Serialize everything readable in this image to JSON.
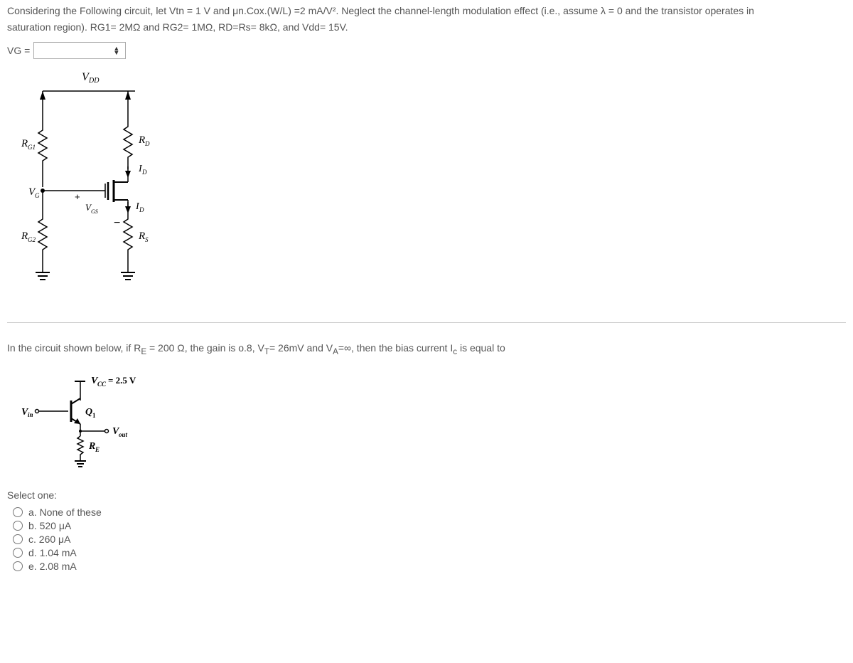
{
  "question1": {
    "line1": "Considering the Following circuit,  let Vtn = 1 V and  μn.Cox.(W/L) =2 mA/V². Neglect the channel-length modulation effect (i.e., assume λ = 0 and the transistor operates in",
    "line2": "saturation region). RG1= 2MΩ and RG2= 1MΩ,  RD=Rs= 8kΩ, and Vdd= 15V.",
    "input_label": "VG ="
  },
  "circuit1": {
    "vdd": "V",
    "vdd_sub": "DD",
    "rg1": "R",
    "rg1_sub": "G1",
    "rg2": "R",
    "rg2_sub": "G2",
    "rd": "R",
    "rd_sub": "D",
    "rs": "R",
    "rs_sub": "S",
    "vg": "V",
    "vg_sub": "G",
    "vgs": "V",
    "vgs_sub": "GS",
    "id": "I",
    "id_sub": "D"
  },
  "question2": {
    "text": "In the circuit shown below, if Rₑ = 200 Ω, the gain is o.8, V_T= 26mV and V_A=∞, then the bias current I_c is equal to"
  },
  "circuit2": {
    "vcc": "V",
    "vcc_sub": "CC",
    "vcc_val": "= 2.5 V",
    "vin": "V",
    "vin_sub": "in",
    "q1": "Q",
    "q1_sub": "1",
    "vout": "V",
    "vout_sub": "out",
    "re": "R",
    "re_sub": "E"
  },
  "select_one": "Select one:",
  "options": {
    "a": "a. None of these",
    "b": "b. 520 μA",
    "c": "c. 260 μA",
    "d": "d. 1.04 mA",
    "e": "e. 2.08 mA"
  }
}
